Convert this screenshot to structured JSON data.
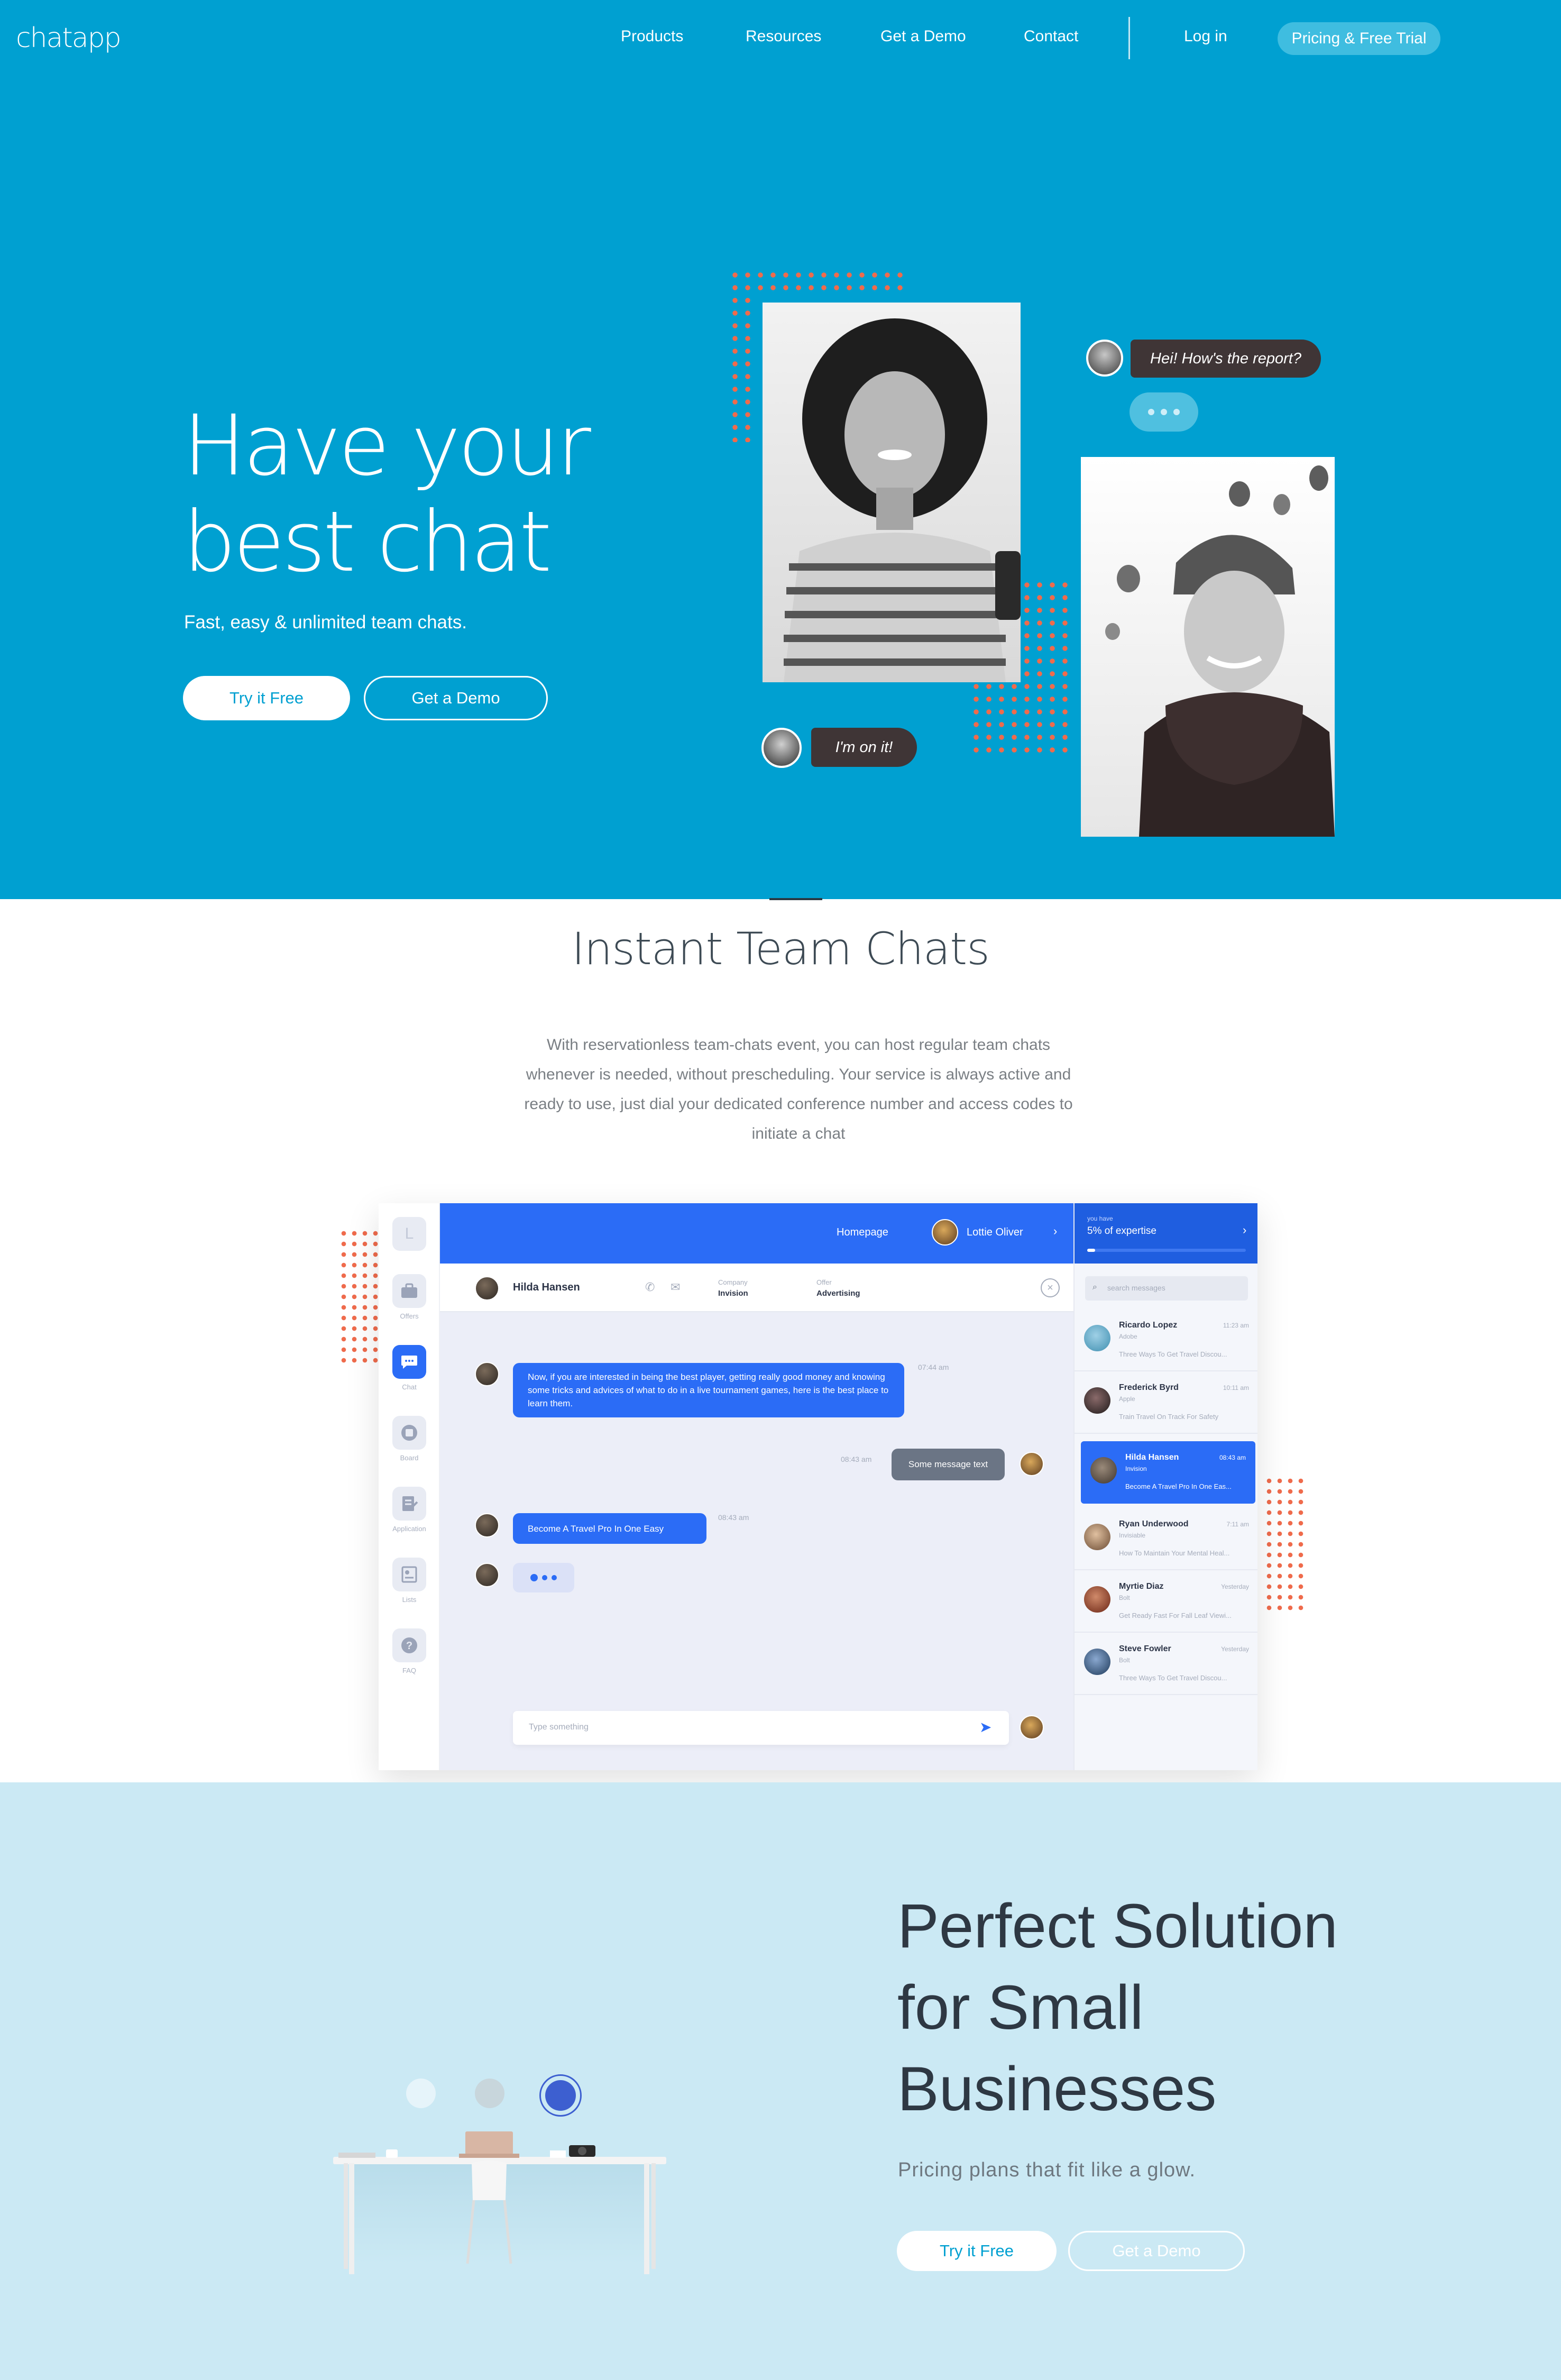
{
  "nav": {
    "logo": "chatapp",
    "links": [
      "Products",
      "Resources",
      "Get a Demo",
      "Contact"
    ],
    "login": "Log in",
    "cta": "Pricing & Free Trial"
  },
  "hero": {
    "title_line1": "Have your",
    "title_line2": "best chat",
    "subtitle": "Fast, easy & unlimited team chats.",
    "try_button": "Try it Free",
    "demo_button": "Get a Demo",
    "bubble_top": "Hei! How's the report?",
    "bubble_bottom": "I'm on it!"
  },
  "section2": {
    "title": "Instant Team Chats",
    "paragraph": "With reservationless team-chats event, you can host regular team chats whenever is needed, without prescheduling. Your service is always active and ready to use, just dial your dedicated conference number and access codes to initiate a chat"
  },
  "app": {
    "logo_letter": "L",
    "sidebar": [
      "Offers",
      "Chat",
      "Board",
      "Application",
      "Lists",
      "FAQ"
    ],
    "top_link": "Homepage",
    "top_user": "Lottie Oliver",
    "expertise_label": "you have",
    "expertise_value": "5% of expertise",
    "chat_contact": "Hilda Hansen",
    "company_label": "Company",
    "company_value": "Invision",
    "offer_label": "Offer",
    "offer_value": "Advertising",
    "search_placeholder": "search messages",
    "messages": [
      {
        "text": "Now, if you are interested in being the best player, getting really good money and knowing some tricks and advices of what to do in a live tournament games, here is the best place to learn them.",
        "time": "07:44 am"
      },
      {
        "text": "Some message text",
        "time": "08:43 am"
      },
      {
        "text": "Become A Travel Pro In One Easy",
        "time": "08:43 am"
      }
    ],
    "input_placeholder": "Type something",
    "contacts": [
      {
        "name": "Ricardo Lopez",
        "company": "Adobe",
        "time": "11:23 am",
        "msg": "Three Ways To Get Travel Discou...",
        "color": "#3f8fb0"
      },
      {
        "name": "Frederick Byrd",
        "company": "Apple",
        "time": "10:11 am",
        "msg": "Train Travel On Track For Safety",
        "color": "#1f1a1a"
      },
      {
        "name": "Hilda Hansen",
        "company": "Invision",
        "time": "08:43 am",
        "msg": "Become A Travel Pro In One Eas...",
        "color": "#5b4f46"
      },
      {
        "name": "Ryan Underwood",
        "company": "Invisiable",
        "time": "7:11 am",
        "msg": "How To Maintain Your Mental Heal...",
        "color": "#9a7a62"
      },
      {
        "name": "Myrtie Diaz",
        "company": "Bolt",
        "time": "Yesterday",
        "msg": "Get Ready Fast For Fall Leaf Viewi...",
        "color": "#8e3a24"
      },
      {
        "name": "Steve Fowler",
        "company": "Bolt",
        "time": "Yesterday",
        "msg": "Three Ways To Get Travel Discou...",
        "color": "#2f5d8a"
      }
    ]
  },
  "section3": {
    "title_line1": "Perfect Solution",
    "title_line2": "for Small",
    "title_line3": "Businesses",
    "subtitle": "Pricing plans that fit like a glow.",
    "try_button": "Try it Free",
    "demo_button": "Get a Demo"
  },
  "colors": {
    "hero_bg": "#00a0d1",
    "accent_blue": "#2b6cf6",
    "dot_orange": "#ef6b4c",
    "section3_bg": "#cbe9f4"
  }
}
